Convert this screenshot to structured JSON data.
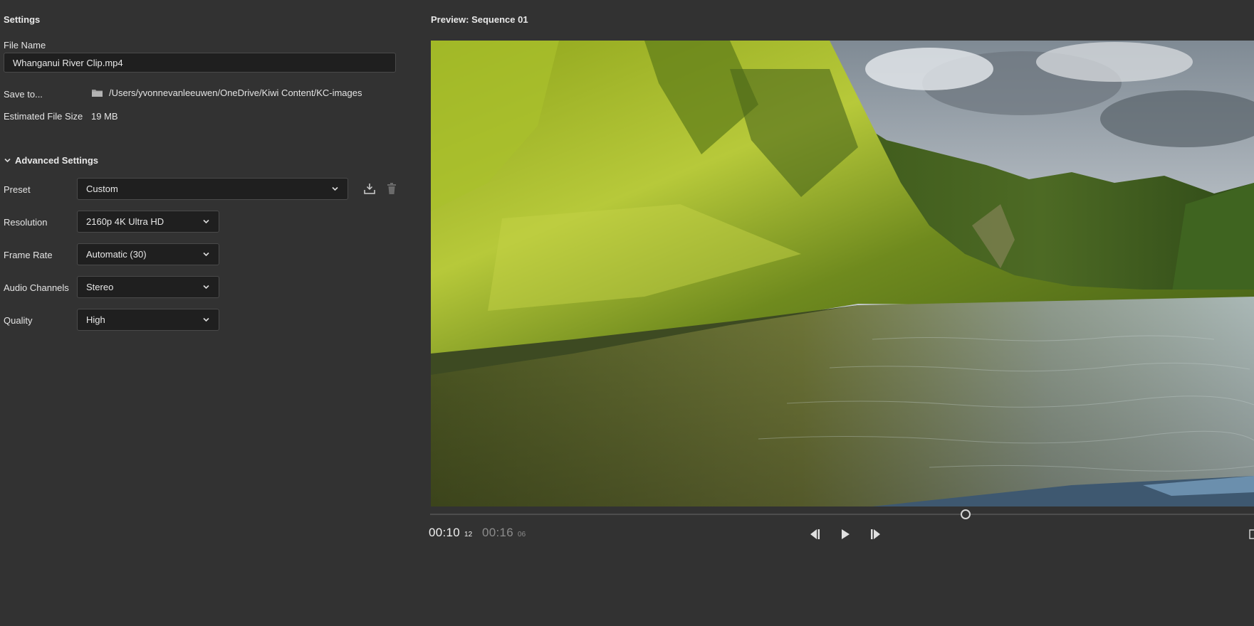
{
  "settings": {
    "title": "Settings",
    "file_name_label": "File Name",
    "file_name_value": "Whanganui River Clip.mp4",
    "save_to_label": "Save to...",
    "save_to_path": "/Users/yvonnevanleeuwen/OneDrive/Kiwi Content/KC-images",
    "est_size_label": "Estimated File Size",
    "est_size_value": "19 MB"
  },
  "advanced": {
    "header_label": "Advanced Settings",
    "preset": {
      "label": "Preset",
      "value": "Custom"
    },
    "resolution": {
      "label": "Resolution",
      "value": "2160p 4K Ultra HD"
    },
    "frame_rate": {
      "label": "Frame Rate",
      "value": "Automatic (30)"
    },
    "audio_channels": {
      "label": "Audio Channels",
      "value": "Stereo"
    },
    "quality": {
      "label": "Quality",
      "value": "High"
    }
  },
  "preview": {
    "title": "Preview: Sequence 01",
    "current_time": "00:10",
    "current_frames": "12",
    "duration_time": "00:16",
    "duration_frames": "06",
    "playback_progress": 0.634
  },
  "icons": {
    "folder": "folder-icon",
    "save_preset": "save-preset-icon",
    "delete_preset": "trash-icon",
    "step_back": "step-back-icon",
    "play": "play-icon",
    "step_forward": "step-forward-icon"
  },
  "colors": {
    "background": "#323232",
    "field_background": "#1f1f1f",
    "border": "#4a4a4a",
    "text": "#e6e6e6",
    "muted_text": "#8c8c8c"
  }
}
